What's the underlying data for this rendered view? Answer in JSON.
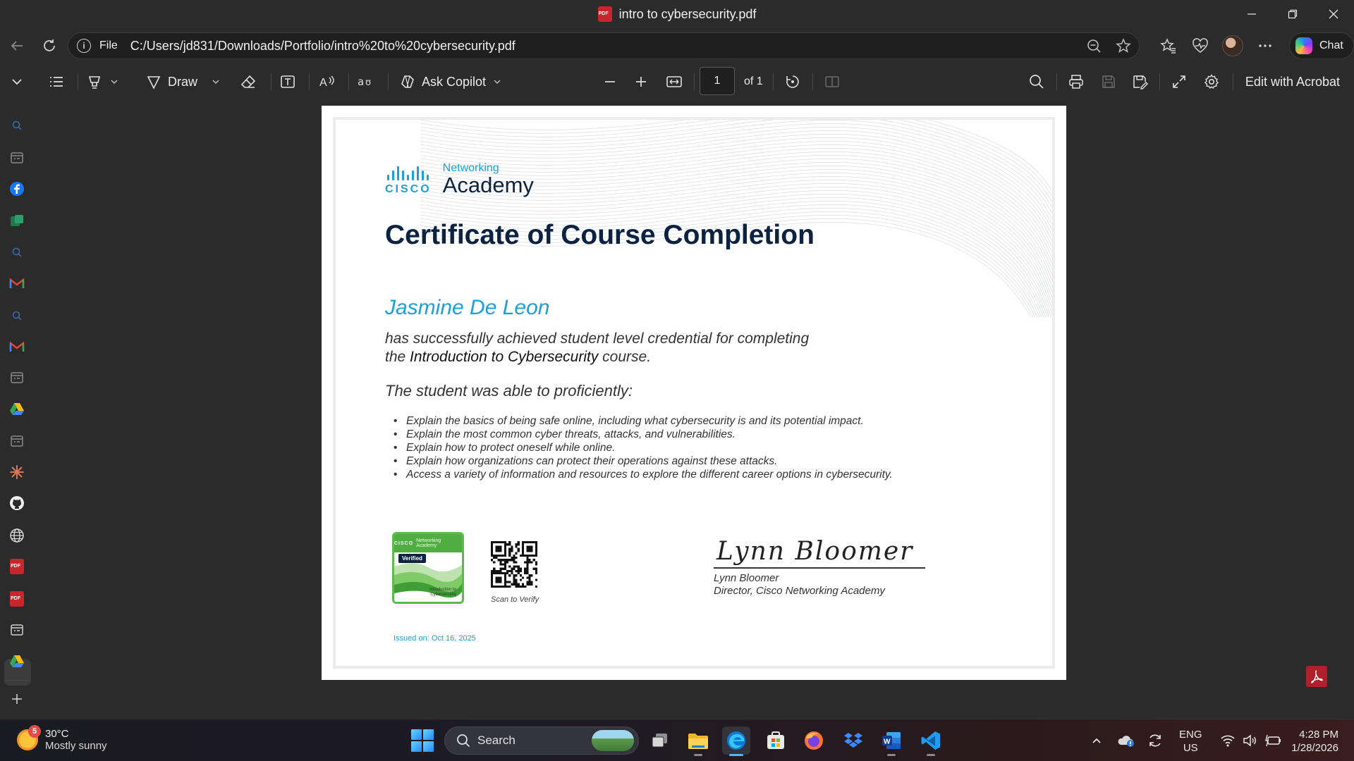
{
  "window": {
    "title": "intro to cybersecurity.pdf",
    "controls": [
      "minimize",
      "restore",
      "close"
    ]
  },
  "addressbar": {
    "scheme_label": "File",
    "url": "C:/Users/jd831/Downloads/Portfolio/intro%20to%20cybersecurity.pdf"
  },
  "browser_toolbar": {
    "chat_label": "Chat"
  },
  "pdf_toolbar": {
    "draw_label": "Draw",
    "copilot_label": "Ask Copilot",
    "page_current": "1",
    "page_total": "of 1",
    "edit_label": "Edit with Acrobat"
  },
  "certificate": {
    "logo_small": "Networking",
    "logo_large": "Academy",
    "logo_brand": "CISCO",
    "title": "Certificate of Course Completion",
    "student_name": "Jasmine De Leon",
    "achieve_line1": "has successfully achieved student level credential for completing",
    "achieve_prefix": "the ",
    "course_name": "Introduction to Cybersecurity",
    "achieve_suffix": " course.",
    "proficient_heading": "The student was able to proficiently:",
    "skills": [
      "Explain the basics of being safe online, including what cybersecurity is and its potential impact.",
      "Explain the most common cyber threats, attacks, and vulnerabilities.",
      "Explain how to protect oneself while online.",
      "Explain how organizations can protect their operations against these attacks.",
      "Access a variety of information and resources to explore the different career options in cybersecurity."
    ],
    "badge": {
      "brand": "CISCO",
      "program": "Networking Academy",
      "status": "Verified",
      "course": "Introduction to Cybersecurity"
    },
    "scan_label": "Scan to Verify",
    "signature_script": "Lynn Bloomer",
    "signer_name": "Lynn Bloomer",
    "signer_role": "Director, Cisco Networking Academy",
    "issued": "Issued on: Oct 16, 2025"
  },
  "taskbar": {
    "weather_badge": "5",
    "temperature": "30°C",
    "condition": "Mostly sunny",
    "search_label": "Search",
    "lang_line1": "ENG",
    "lang_line2": "US",
    "time": "4:28 PM",
    "date": "1/28/2026"
  },
  "colors": {
    "cisco_blue": "#1ba0d7",
    "navy": "#0b2240",
    "badge_green": "#4fae3f",
    "pdf_red": "#c9252c"
  }
}
